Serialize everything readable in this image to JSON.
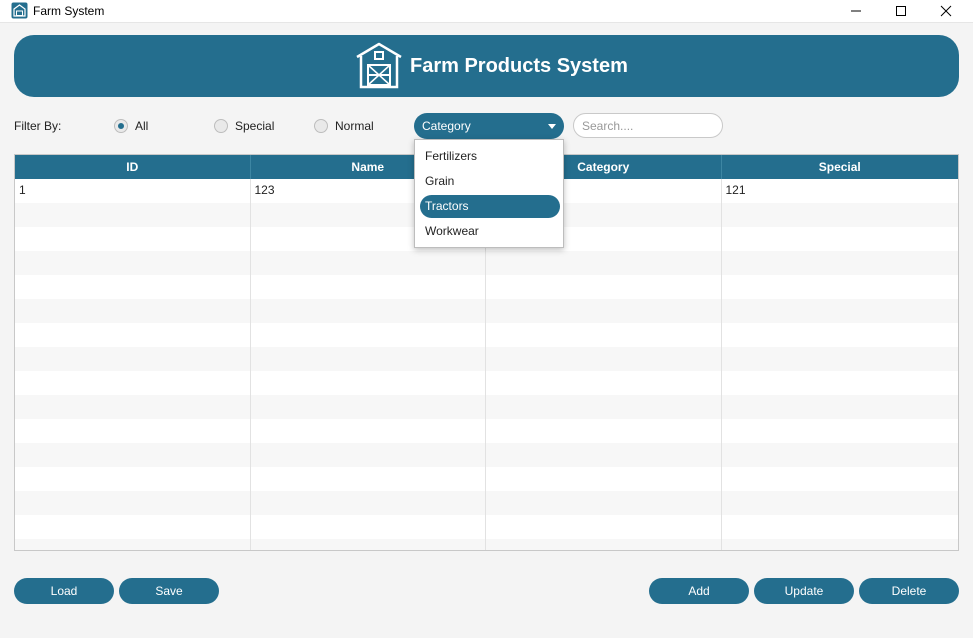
{
  "window": {
    "title": "Farm System",
    "icon": "barn-icon",
    "controls": [
      "minimize-icon",
      "maximize-icon",
      "close-icon"
    ]
  },
  "header": {
    "title": "Farm Products System",
    "icon": "barn-icon"
  },
  "filter": {
    "label": "Filter By:",
    "radios": [
      {
        "label": "All",
        "selected": true
      },
      {
        "label": "Special",
        "selected": false
      },
      {
        "label": "Normal",
        "selected": false
      }
    ],
    "category": {
      "value": "Category",
      "options": [
        "Fertilizers",
        "Grain",
        "Tractors",
        "Workwear"
      ],
      "highlighted": "Tractors"
    },
    "search": {
      "placeholder": "Search....",
      "value": ""
    }
  },
  "table": {
    "columns": [
      "ID",
      "Name",
      "Category",
      "Special"
    ],
    "rows": [
      [
        "1",
        "123",
        "",
        "121"
      ]
    ],
    "empty_rows": 15
  },
  "buttons": {
    "load": "Load",
    "save": "Save",
    "add": "Add",
    "update": "Update",
    "delete": "Delete"
  },
  "colors": {
    "accent": "#246e8e",
    "background": "#f4f4f4"
  }
}
